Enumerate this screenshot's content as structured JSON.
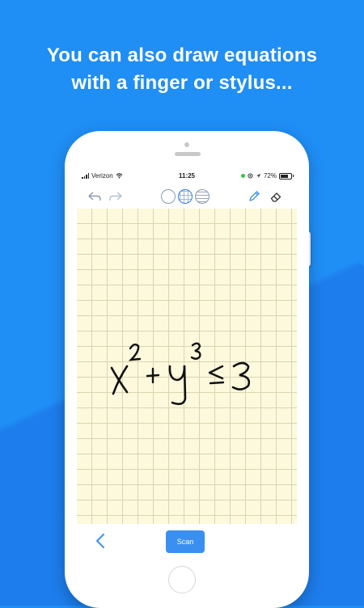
{
  "headline": {
    "line1": "You can also draw equations",
    "line2": "with a finger or stylus..."
  },
  "status_bar": {
    "carrier": "Verizon",
    "time": "11:25",
    "battery": "72%"
  },
  "toolbar": {
    "undo_icon": "undo-icon",
    "redo_icon": "redo-icon",
    "paper_options": [
      "blank",
      "grid",
      "lined"
    ],
    "selected_paper": "grid",
    "pen_icon": "pencil-icon",
    "eraser_icon": "eraser-icon"
  },
  "canvas": {
    "handwritten_equation": {
      "base1": "x",
      "exp1": "2",
      "plus": "+",
      "base2": "y",
      "exp2": "3",
      "relation": "≤",
      "rhs": "3"
    }
  },
  "bottom_bar": {
    "back_icon": "chevron-left-icon",
    "scan_label": "Scan"
  },
  "colors": {
    "background": "#1f8ef5",
    "accent": "#3b8ff0",
    "paper": "#fdf9dd"
  }
}
